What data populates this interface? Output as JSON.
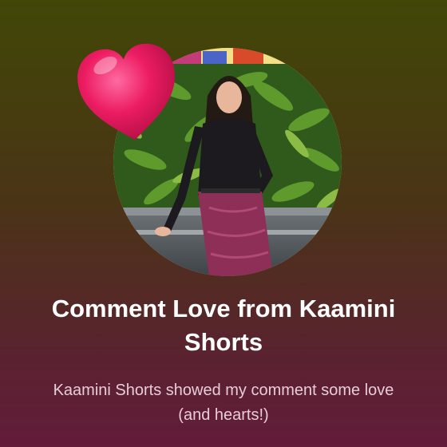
{
  "card": {
    "title": "Comment Love from Kaamini Shorts",
    "subtitle": "Kaamini Shorts showed my comment some love (and hearts!)"
  },
  "icons": {
    "heart": "heart-icon"
  },
  "colors": {
    "background_top": "#414707",
    "background_bottom": "#631c3a",
    "heart": "#e8145c",
    "title": "#ffffff",
    "subtitle": "#e7cdd6"
  }
}
